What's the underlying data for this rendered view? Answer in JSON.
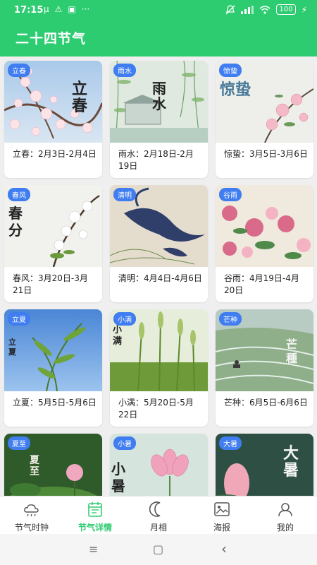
{
  "status_bar": {
    "time": "17:15",
    "left_icons": [
      "µ",
      "⚠",
      "▣",
      "···"
    ],
    "battery": "100"
  },
  "app": {
    "title": "二十四节气",
    "accent": "#2ecc71",
    "badge_color": "#3f7df0"
  },
  "cards": [
    {
      "badge": "立春",
      "caption": "立春：2月3日-2月4日",
      "art_text": "立春"
    },
    {
      "badge": "雨水",
      "caption": "雨水：2月18日-2月19日",
      "art_text": "雨水"
    },
    {
      "badge": "惊蛰",
      "caption": "惊蛰：3月5日-3月6日",
      "art_text": "惊蛰"
    },
    {
      "badge": "春风",
      "caption": "春风：3月20日-3月21日",
      "art_text": "春分"
    },
    {
      "badge": "清明",
      "caption": "清明：4月4日-4月6日",
      "art_text": ""
    },
    {
      "badge": "谷雨",
      "caption": "谷雨：4月19日-4月20日",
      "art_text": ""
    },
    {
      "badge": "立夏",
      "caption": "立夏：5月5日-5月6日",
      "art_text": "立夏"
    },
    {
      "badge": "小满",
      "caption": "小满：5月20日-5月22日",
      "art_text": "小满"
    },
    {
      "badge": "芒种",
      "caption": "芒种：6月5日-6月6日",
      "art_text": "芒種"
    },
    {
      "badge": "夏至",
      "caption": "",
      "art_text": "夏至"
    },
    {
      "badge": "小暑",
      "caption": "",
      "art_text": "小暑"
    },
    {
      "badge": "大暑",
      "caption": "",
      "art_text": "大暑"
    }
  ],
  "bottom_nav": [
    {
      "label": "节气时钟",
      "icon": "weather-cloud-icon",
      "active": false
    },
    {
      "label": "节气详情",
      "icon": "calendar-icon",
      "active": true
    },
    {
      "label": "月相",
      "icon": "moon-icon",
      "active": false
    },
    {
      "label": "海报",
      "icon": "poster-icon",
      "active": false
    },
    {
      "label": "我的",
      "icon": "user-icon",
      "active": false
    }
  ],
  "system_nav": {
    "menu": "≡",
    "home": "▢",
    "back": "‹"
  }
}
